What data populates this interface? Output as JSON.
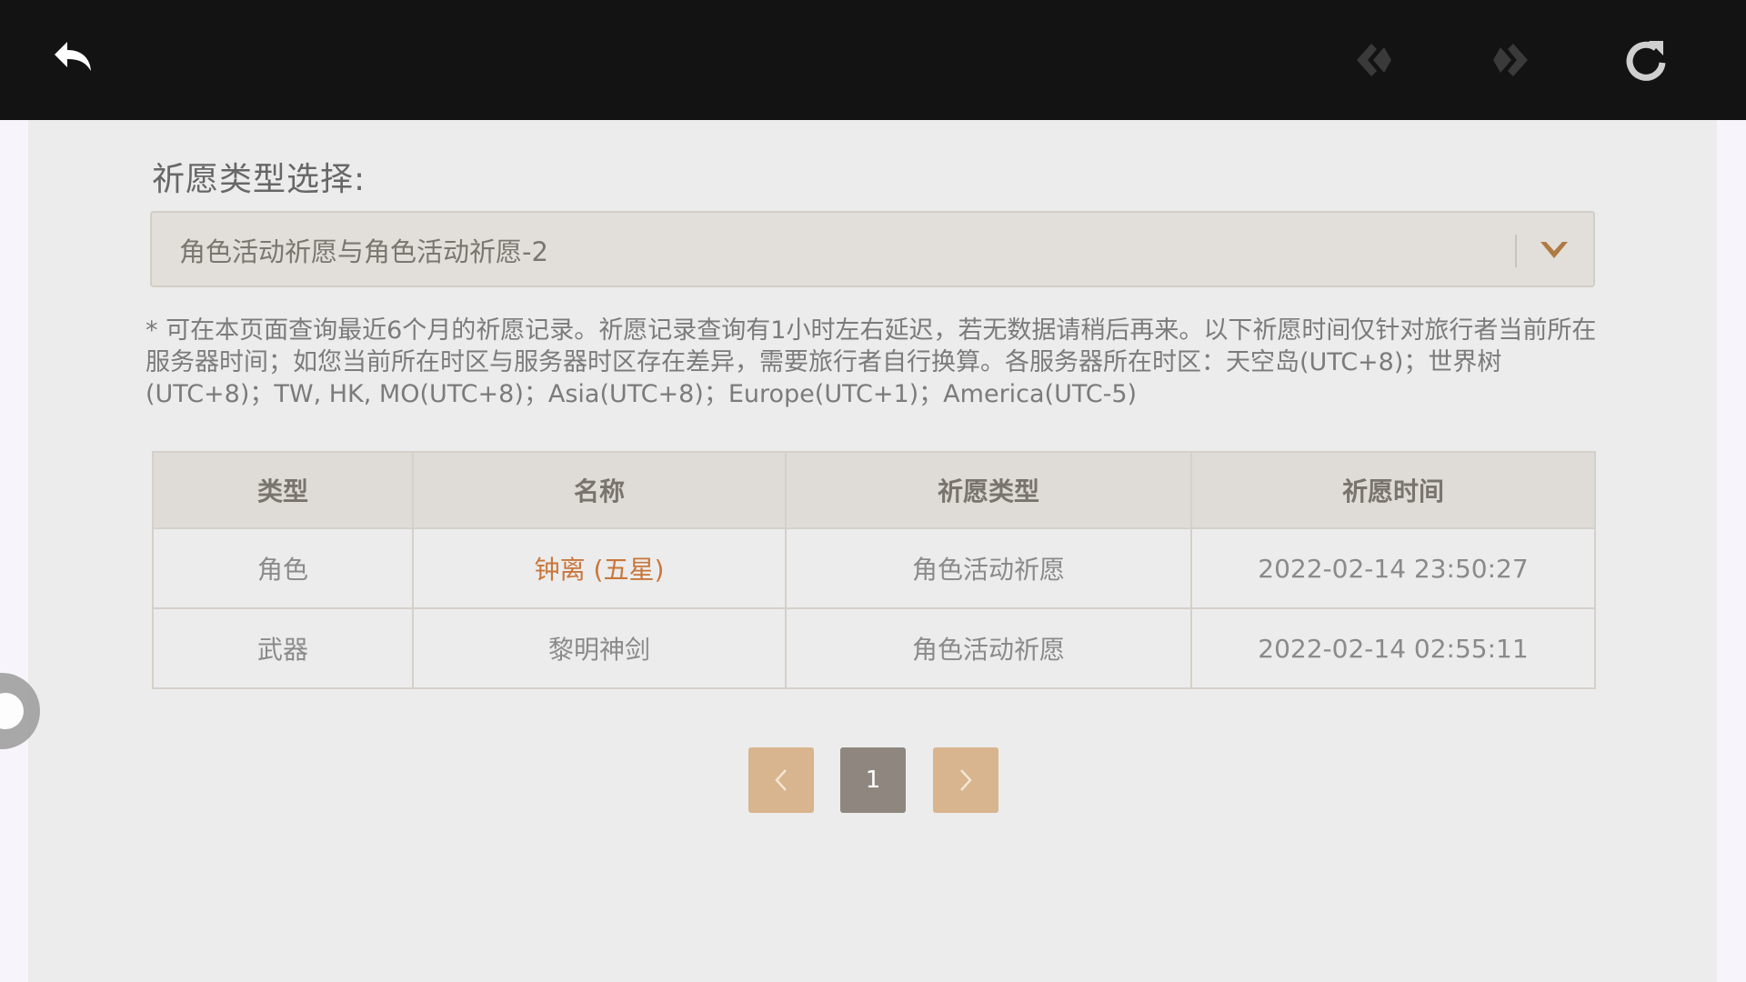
{
  "topbar": {
    "icons": [
      "back-arrow-icon",
      "nav-back-icon",
      "nav-forward-icon",
      "refresh-icon"
    ]
  },
  "filter": {
    "label": "祈愿类型选择:",
    "selected": "角色活动祈愿与角色活动祈愿-2"
  },
  "notice": "* 可在本页面查询最近6个月的祈愿记录。祈愿记录查询有1小时左右延迟，若无数据请稍后再来。以下祈愿时间仅针对旅行者当前所在服务器时间；如您当前所在时区与服务器时区存在差异，需要旅行者自行换算。各服务器所在时区：天空岛(UTC+8)；世界树(UTC+8)；TW, HK, MO(UTC+8)；Asia(UTC+8)；Europe(UTC+1)；America(UTC-5)",
  "table": {
    "headers": [
      "类型",
      "名称",
      "祈愿类型",
      "祈愿时间"
    ],
    "rows": [
      {
        "type": "角色",
        "name": "钟离 (五星)",
        "wish_type": "角色活动祈愿",
        "time": "2022-02-14 23:50:27"
      },
      {
        "type": "武器",
        "name": "黎明神剑",
        "wish_type": "角色活动祈愿",
        "time": "2022-02-14 02:55:11"
      }
    ]
  },
  "pagination": {
    "current": "1"
  },
  "colors": {
    "topbar": "#131313",
    "background": "#ececec",
    "accent": "#d8b58e",
    "five_star": "#c9763a",
    "page_current": "#8f877f"
  }
}
